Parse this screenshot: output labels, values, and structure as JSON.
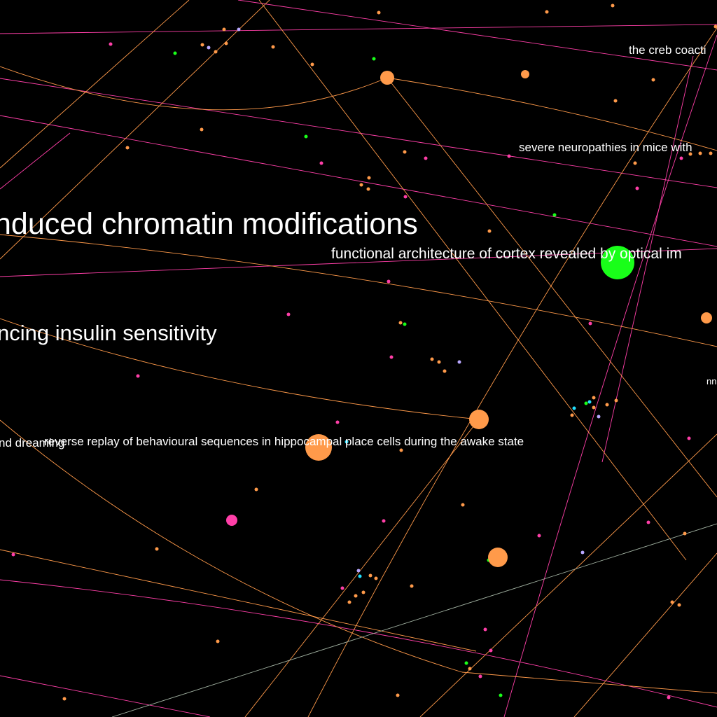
{
  "colors": {
    "background": "#000000",
    "orange": "#ff9a4a",
    "pink": "#ff3fa8",
    "green": "#19ff19",
    "cyan": "#22e0ff",
    "lavender": "#b9a8ff",
    "gray": "#a0b0a0",
    "label": "#ffffff"
  },
  "labels": {
    "chromatin": "nduced chromatin modifications",
    "insulin": "ncing insulin sensitivity",
    "cortex": "functional architecture of cortex revealed by optical im",
    "creb": "the creb coacti",
    "neuropathies": "severe neuropathies in mice with",
    "replay": "reverse replay of behavioural sequences in hippocampal place cells during the awake state",
    "dreaming": "nd dreaming",
    "edge_fragment": "nn"
  }
}
